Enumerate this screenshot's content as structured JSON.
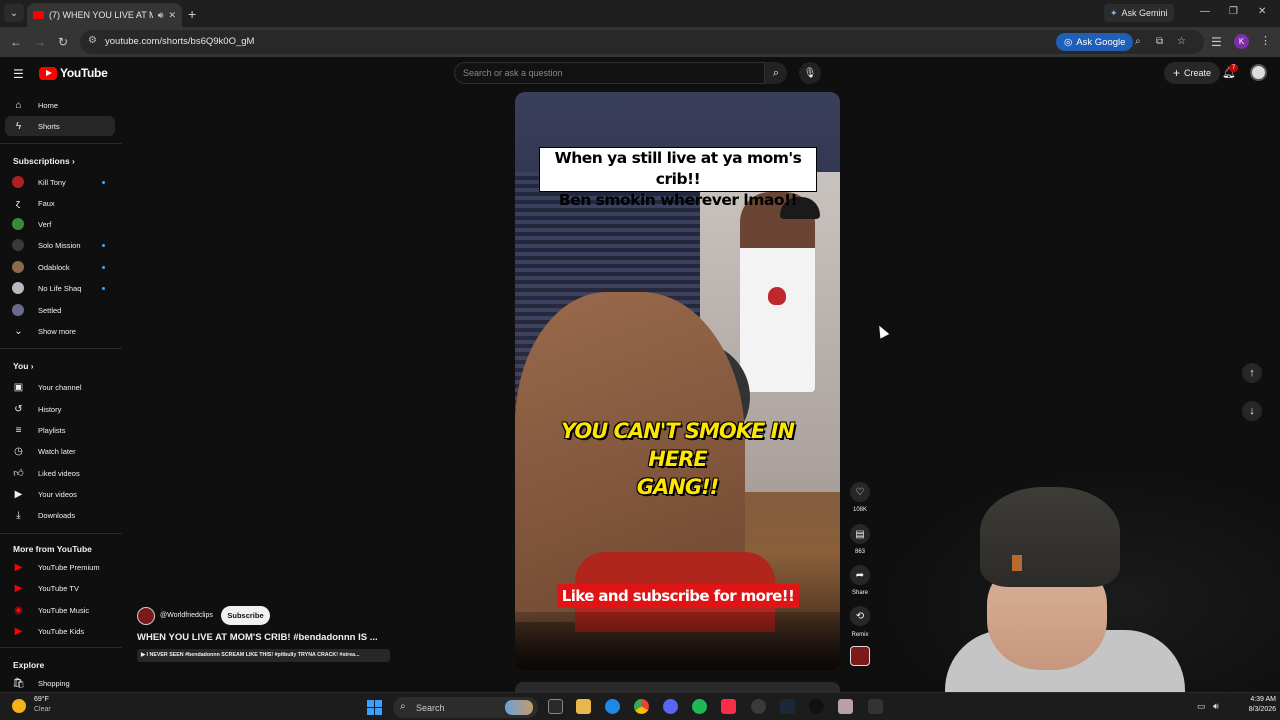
{
  "browser": {
    "tab_title": "(7) WHEN YOU LIVE AT MO",
    "ask_gemini": "Ask Gemini",
    "url": "youtube.com/shorts/bs6Q9k0O_gM",
    "ask_google": "Ask Google",
    "profile_initial": "K"
  },
  "youtube": {
    "logo": "YouTube",
    "search_placeholder": "Search or ask a question",
    "create_label": "Create",
    "notif_count": "7"
  },
  "sidebar": {
    "home": "Home",
    "shorts": "Shorts",
    "subscriptions_heading": "Subscriptions",
    "subscriptions": [
      {
        "label": "Kill Tony",
        "color": "#b02020",
        "new": true
      },
      {
        "label": "Faux",
        "color": "#0f0f0f",
        "new": false
      },
      {
        "label": "Verf",
        "color": "#3a8a3a",
        "new": false
      },
      {
        "label": "Solo Mission",
        "color": "#3a3a3a",
        "new": true
      },
      {
        "label": "Odablock",
        "color": "#8a6a4a",
        "new": true
      },
      {
        "label": "No Life Shaq",
        "color": "#b9b9b9",
        "new": true
      },
      {
        "label": "Settled",
        "color": "#6a6a8a",
        "new": false
      }
    ],
    "show_more": "Show more",
    "you_heading": "You",
    "you_items": [
      "Your channel",
      "History",
      "Playlists",
      "Watch later",
      "Liked videos",
      "Your videos",
      "Downloads"
    ],
    "more_heading": "More from YouTube",
    "more_items": [
      "YouTube Premium",
      "YouTube TV",
      "YouTube Music",
      "YouTube Kids"
    ],
    "explore_heading": "Explore",
    "explore_items": [
      "Shopping"
    ]
  },
  "short": {
    "caption_top_line1": "When ya still live at ya mom's crib!!",
    "caption_top_line2": "Ben smokin wherever lmao!!",
    "caption_middle_line1": "YOU CAN'T SMOKE IN HERE",
    "caption_middle_line2": "GANG!!",
    "caption_bottom": "Like and subscribe for more!!",
    "likes": "108K",
    "comments": "863",
    "share_label": "Share",
    "remix_label": "Remix",
    "channel_handle": "@Worldfriedclips",
    "subscribe_label": "Subscribe",
    "title": "WHEN YOU LIVE AT MOM'S CRIB! #bendadonnn IS ...",
    "subtitle": "▶ I NEVER SEEN #bendadonnn SCREAM LIKE THIS! #pitbully TRYNA CRACK! #strea..."
  },
  "taskbar": {
    "temp": "69°F",
    "condition": "Clear",
    "search_label": "Search",
    "time": "4:39 AM",
    "date": "8/3/2026"
  },
  "icons": {
    "menu": "hamburger-icon",
    "search": "search-icon",
    "mic": "mic-icon",
    "bell": "bell-icon",
    "like": "heart-icon",
    "comment": "comment-icon",
    "share": "share-icon",
    "remix": "remix-icon"
  }
}
